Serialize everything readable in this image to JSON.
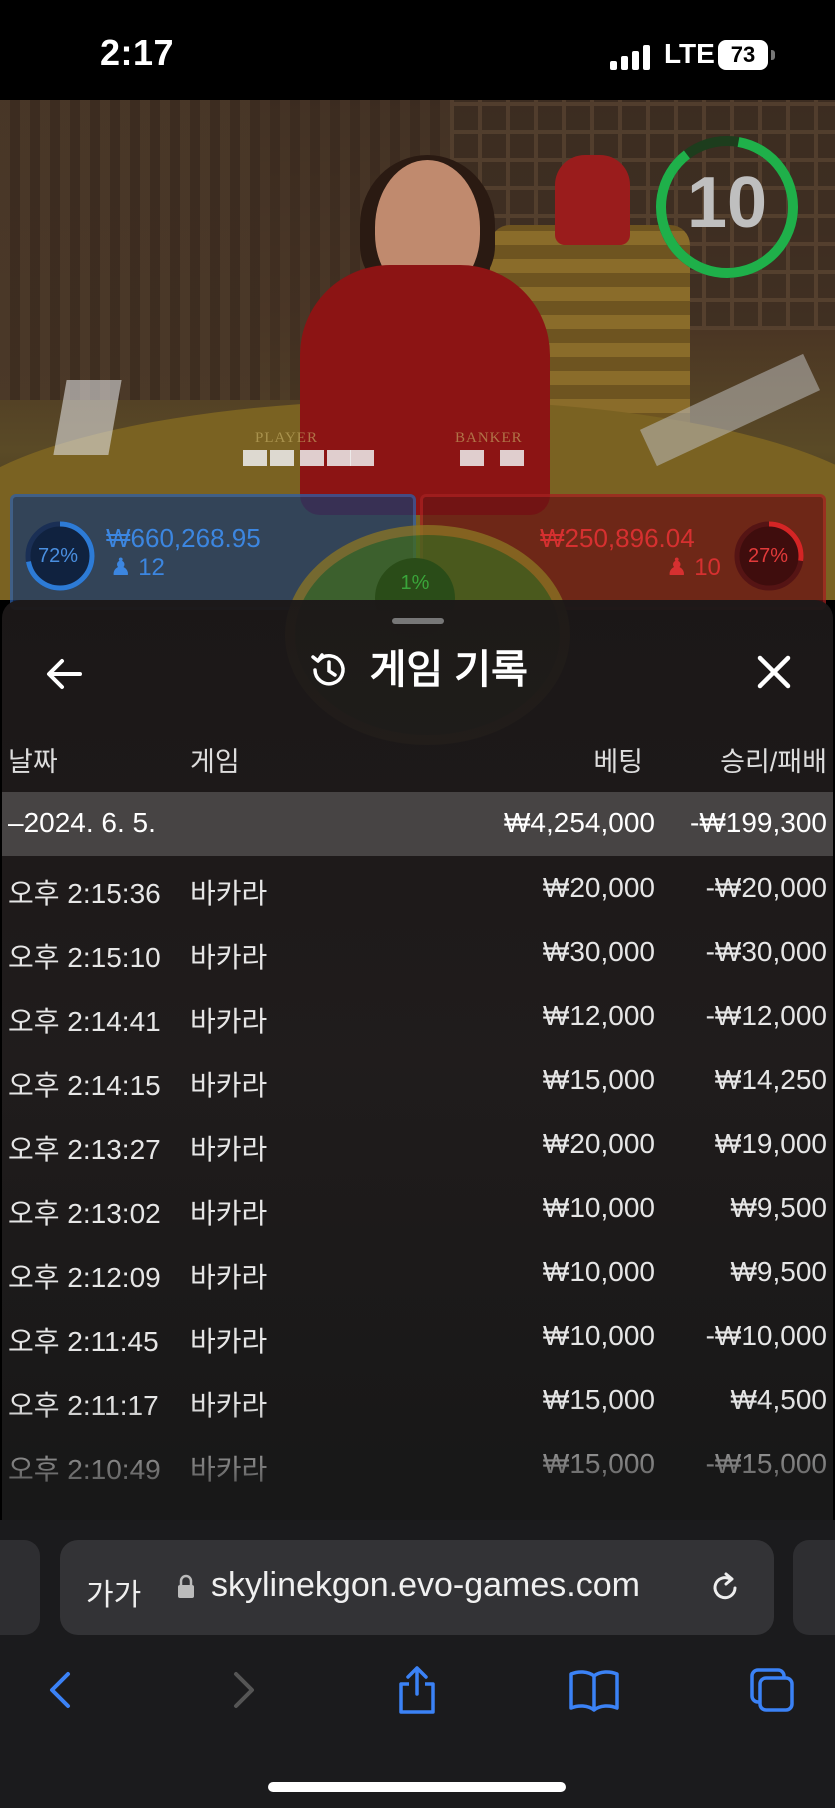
{
  "status": {
    "time": "2:17",
    "network": "LTE",
    "battery": "73"
  },
  "game": {
    "timer": "10",
    "table_labels": {
      "player": "PLAYER",
      "banker": "BANKER"
    },
    "player": {
      "percent": "72%",
      "amount": "₩660,268.95",
      "count": "12"
    },
    "banker": {
      "percent": "27%",
      "amount": "₩250,896.04",
      "count": "10"
    },
    "tie": {
      "percent": "1%"
    }
  },
  "history": {
    "title": "게임 기록",
    "columns": {
      "date": "날짜",
      "game": "게임",
      "bet": "베팅",
      "result": "승리/패배"
    },
    "summary": {
      "date": "–2024. 6. 5.",
      "bet": "₩4,254,000",
      "result": "-₩199,300"
    },
    "rows": [
      {
        "time": "오후 2:15:36",
        "game": "바카라",
        "bet": "₩20,000",
        "result": "-₩20,000"
      },
      {
        "time": "오후 2:15:10",
        "game": "바카라",
        "bet": "₩30,000",
        "result": "-₩30,000"
      },
      {
        "time": "오후 2:14:41",
        "game": "바카라",
        "bet": "₩12,000",
        "result": "-₩12,000"
      },
      {
        "time": "오후 2:14:15",
        "game": "바카라",
        "bet": "₩15,000",
        "result": "₩14,250"
      },
      {
        "time": "오후 2:13:27",
        "game": "바카라",
        "bet": "₩20,000",
        "result": "₩19,000"
      },
      {
        "time": "오후 2:13:02",
        "game": "바카라",
        "bet": "₩10,000",
        "result": "₩9,500"
      },
      {
        "time": "오후 2:12:09",
        "game": "바카라",
        "bet": "₩10,000",
        "result": "₩9,500"
      },
      {
        "time": "오후 2:11:45",
        "game": "바카라",
        "bet": "₩10,000",
        "result": "-₩10,000"
      },
      {
        "time": "오후 2:11:17",
        "game": "바카라",
        "bet": "₩15,000",
        "result": "₩4,500"
      },
      {
        "time": "오후 2:10:49",
        "game": "바카라",
        "bet": "₩15,000",
        "result": "-₩15,000"
      }
    ]
  },
  "browser": {
    "text_size": "가가",
    "url": "skylinekgon.evo-games.com",
    "accent": "#3b82f6"
  }
}
